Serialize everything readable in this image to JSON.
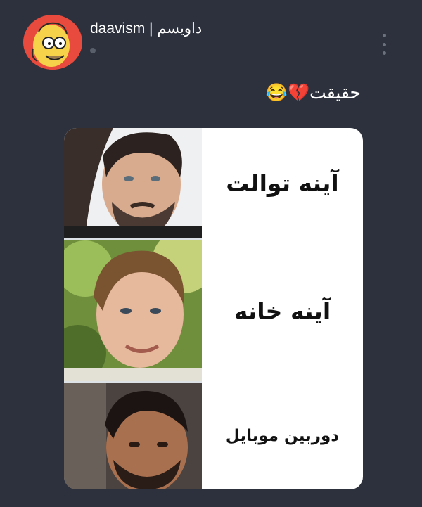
{
  "post": {
    "username": "daavism | داویسم",
    "caption": "حقیقت💔😂"
  },
  "meme": {
    "rows": [
      {
        "label": "آینه توالت"
      },
      {
        "label": "آینه خانه"
      },
      {
        "label": "دوربین موبایل"
      }
    ]
  },
  "icons": {
    "avatar": "homer-simpson-avatar",
    "menu": "more-vertical-icon"
  },
  "colors": {
    "background": "#2c313d",
    "card": "#ffffff",
    "text": "#ffffff"
  }
}
